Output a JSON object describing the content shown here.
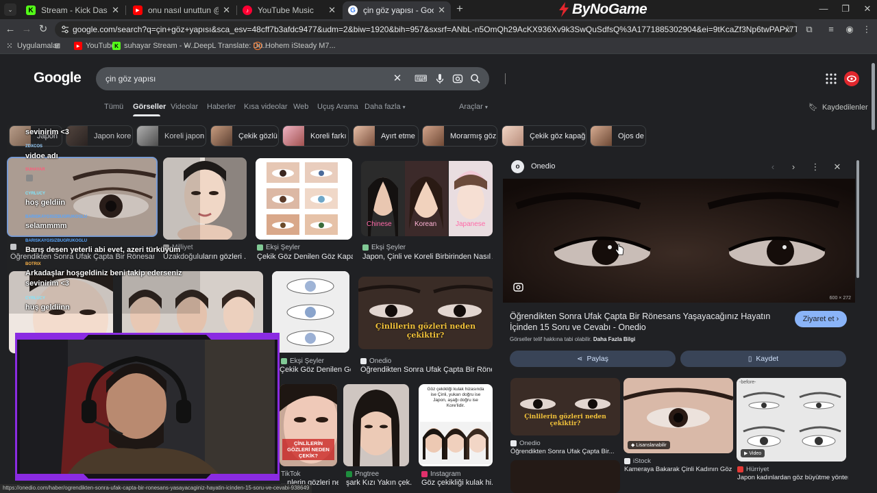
{
  "browser": {
    "tabs": [
      {
        "title": "Stream - Kick Dashboard",
        "fav": "K",
        "fav_color": "#53fc18"
      },
      {
        "title": "onu nasıl unuttun @mfatihergi",
        "fav": "▶",
        "fav_color": "#ff0000"
      },
      {
        "title": "YouTube Music",
        "fav": "♪",
        "fav_color": "#ff0033"
      },
      {
        "title": "çin göz yapısı - Google'da Ara",
        "fav": "G",
        "fav_color": "#ffffff"
      }
    ],
    "brand": "ByNoGame",
    "url": "google.com/search?q=çin+göz+yapısı&sca_esv=48cff7b3afdc9477&udm=2&biw=1920&bih=957&sxsrf=ANbL-n5OmQh29AcKX936Xv9k3SwQuSdfsQ%3A1771885302904&ei=9tKcaZf3Np6twPAPx7Ty4Ac&ved=0ahUKEwiXyr-Q0_CSAxWeFhAIHUeaH...",
    "bookmarks": [
      {
        "label": "Uygulamalar",
        "icon": "grid-icon"
      },
      {
        "label": "YouTube",
        "icon": "youtube-icon"
      },
      {
        "label": "suhayar Stream - W...",
        "icon": "kick-icon"
      },
      {
        "label": "DeepL Translate: Dü...",
        "icon": "deepl-icon"
      },
      {
        "label": "Hohem iSteady M7...",
        "icon": "hohem-icon"
      }
    ],
    "status_url": "https://onedio.com/haber/ogrendikten-sonra-ufak-capta-bir-ronesans-yasayacaginiz-hayatin-icinden-15-soru-ve-cevabi-938649"
  },
  "google": {
    "logo": "Google",
    "query": "çin göz yapısı",
    "tabs": [
      "Tümü",
      "Görseller",
      "Videolar",
      "Haberler",
      "Kısa videolar",
      "Web",
      "Uçuş Arama",
      "Daha fazla",
      "Araçlar"
    ],
    "saved": "Kaydedilenler",
    "chips": [
      "Japon",
      "Japon kore",
      "Koreli japon",
      "Çekik gözlü",
      "Koreli farkı",
      "Ayırt etme",
      "Morarmış göz",
      "Çekik göz kapağı",
      "Ojos de"
    ],
    "results": {
      "r1": {
        "source": "",
        "caption": "Öğrendikten Sonra Ufak Çapta Bir Rönesans ..."
      },
      "r2": {
        "source": "Milliyet",
        "caption": "Uzakdoğuluların gözleri ..."
      },
      "r3": {
        "source": "Ekşi Şeyler",
        "caption": "Çekik Göz Denilen Göz Kapa..."
      },
      "r4": {
        "source": "Ekşi Şeyler",
        "caption": "Japon, Çinli ve Koreli Birbirinden Nasıl Ay..."
      },
      "r7": {
        "source": "Ekşi Şeyler",
        "caption": "Çekik Göz Denilen Gö..."
      },
      "r8": {
        "source": "Onedio",
        "caption": "Öğrendikten Sonra Ufak Çapta Bir Rönes..."
      },
      "r11": {
        "source": "TikTok",
        "caption": "...nlerin gözleri ne..."
      },
      "r12": {
        "source": "Pngtree",
        "caption": "şark Kızı Yakın çek..."
      },
      "r13": {
        "source": "Instagram",
        "caption": "Göz çekikliği kulak hi..."
      }
    },
    "r4_labels": [
      "Chinese",
      "Korean",
      "Japanese"
    ],
    "r8_overlay": "Çinlilerin gözleri neden çekiktir?",
    "r11_overlay": "ÇİNLİLERİN GÖZLERİ NEDEN ÇEKİK?",
    "r13_text": "Göz çekikliği kulak hizasında ise Çinli, yukarı doğru ise Japon, aşağı doğru ise Kore'lidir.",
    "panel": {
      "site": "Onedio",
      "dimensions": "600 × 272",
      "title": "Öğrendikten Sonra Ufak Çapta Bir Rönesans Yaşayacağınız Hayatın İçinden 15 Soru ve Cevabı - Onedio",
      "visit": "Ziyaret et",
      "copyright": "Görseller telif hakkına tabi olabilir.",
      "more_info": "Daha Fazla Bilgi",
      "share": "Paylaş",
      "save": "Kaydet",
      "related": [
        {
          "source": "Onedio",
          "caption": "Öğrendikten Sonra Ufak Çapta Bir...",
          "overlay": "Çinlilerin gözleri neden çekiktir?"
        },
        {
          "source": "iStock",
          "caption": "Kameraya Bakarak Çinli Kadının Göz St...",
          "badge": "Lisanslanabilir"
        },
        {
          "source": "Hürriyet",
          "caption": "Japon kadınlardan göz büyütme yöntemi",
          "badge": "Video",
          "overlay": "-before-"
        }
      ]
    }
  },
  "chat": [
    {
      "user": "",
      "text": "sevinirim <3",
      "color": "#ffffff"
    },
    {
      "user": "ZDXCOS",
      "text": "vidoe adı",
      "color": "#9ad1ff"
    },
    {
      "user": "SUHAYAR",
      "text": "",
      "color": "#ff5b7a"
    },
    {
      "user": "CYRLUCY",
      "text": "hoş geldiin",
      "color": "#7fe7ff"
    },
    {
      "user": "BARISKAYGISIZBUGRUKOGLU",
      "text": "selammmm",
      "color": "#58a6ff"
    },
    {
      "user": "BARISKAYGISIZBUGRUKOGLU",
      "text": "Barış desen yeterli abi evet, azeri türküyüm",
      "color": "#58a6ff"
    },
    {
      "user": "BOTRIX",
      "text": "Arkadaşlar hoşgeldiniz beni takip ederseniz",
      "color": "#ffb64a"
    },
    {
      "user": "",
      "text": "sevinirim <3",
      "color": "#ffffff"
    },
    {
      "user": "CYRLUCY",
      "text": "huş geldiinn",
      "color": "#7fe7ff"
    }
  ]
}
